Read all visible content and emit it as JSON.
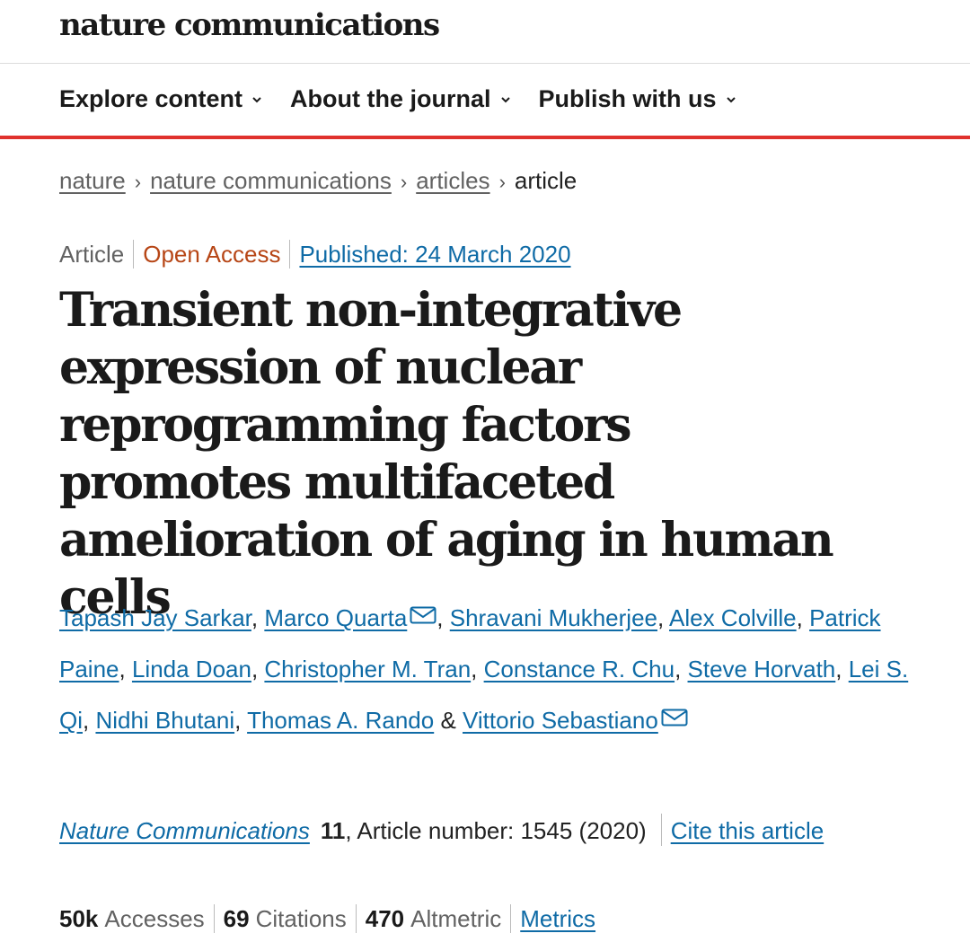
{
  "header": {
    "logo_text": "nature communications"
  },
  "nav": {
    "items": [
      {
        "label": "Explore content"
      },
      {
        "label": "About the journal"
      },
      {
        "label": "Publish with us"
      }
    ]
  },
  "breadcrumb": {
    "items": [
      "nature",
      "nature communications",
      "articles"
    ],
    "current": "article",
    "separator": "›"
  },
  "article": {
    "type": "Article",
    "access": "Open Access",
    "published": "Published: 24 March 2020",
    "title": "Transient non-integrative expression of nuclear reprogramming factors promotes multifaceted amelioration of aging in human cells",
    "authors": [
      "Tapash Jay Sarkar",
      "Marco Quarta",
      "Shravani Mukherjee",
      "Alex Colville",
      "Patrick Paine",
      "Linda Doan",
      "Christopher M. Tran",
      "Constance R. Chu",
      "Steve Horvath",
      "Lei S. Qi",
      "Nidhi Bhutani",
      "Thomas A. Rando",
      "Vittorio Sebastiano"
    ],
    "sep_comma": ", ",
    "sep_and": " & ",
    "journal": "Nature Communications",
    "volume": "11",
    "article_number": ", Article number: 1545 (2020)",
    "cite_label": "Cite this article"
  },
  "metrics": {
    "accesses_value": "50k",
    "accesses_label": "Accesses",
    "citations_value": "69",
    "citations_label": "Citations",
    "altmetric_value": "470",
    "altmetric_label": "Altmetric",
    "metrics_link": "Metrics"
  },
  "colors": {
    "accent_red": "#e0322d",
    "link_blue": "#0f6ba6",
    "open_access": "#b74616"
  }
}
